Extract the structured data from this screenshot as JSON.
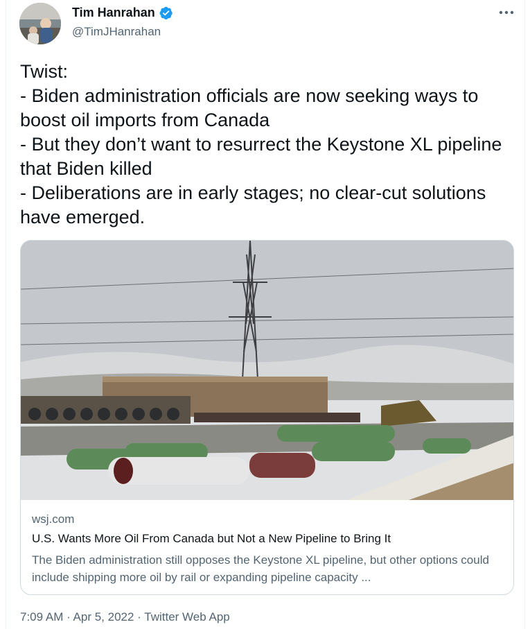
{
  "author": {
    "display_name": "Tim Hanrahan",
    "handle": "@TimJHanrahan",
    "verified": true
  },
  "tweet": {
    "text": "Twist:\n- Biden administration officials are now seeking ways to boost oil imports from Canada\n- But they don’t want to resurrect the Keystone XL pipeline that Biden killed\n- Deliberations are in early stages; no clear-cut solutions have emerged."
  },
  "link_card": {
    "domain": "wsj.com",
    "title": "U.S. Wants More Oil From Canada but Not a New Pipeline to Bring It",
    "description": "The Biden administration still opposes the Keystone XL pipeline, but other options could include shipping more oil by rail or expanding pipeline capacity ..."
  },
  "meta": {
    "time": "7:09 AM",
    "date": "Apr 5, 2022",
    "source": "Twitter Web App",
    "separator": " · "
  },
  "icons": {
    "more": "more-horizontal-icon",
    "verified": "verified-badge-icon"
  },
  "colors": {
    "verified": "#1d9bf0",
    "secondary_text": "#536471",
    "primary_text": "#0f1419",
    "border": "#cfd9de"
  }
}
